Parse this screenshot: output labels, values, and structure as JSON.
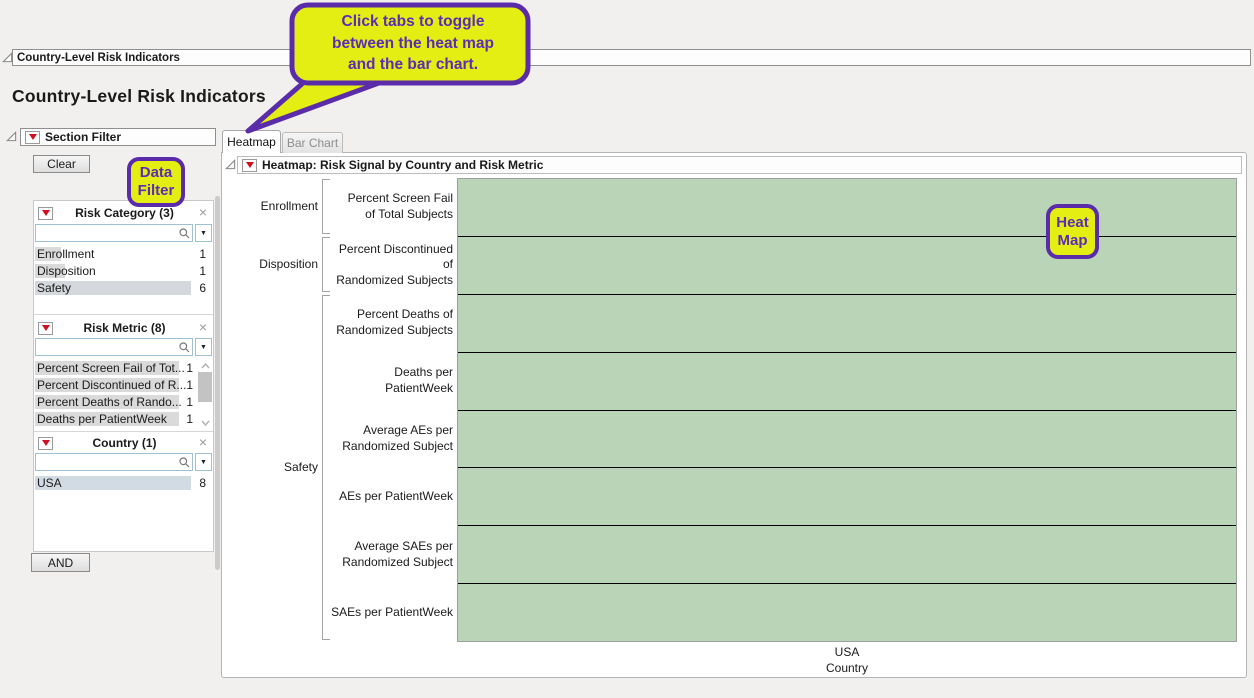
{
  "window": {
    "outline_title": "Country-Level Risk Indicators",
    "page_title": "Country-Level Risk Indicators"
  },
  "section_filter": {
    "title": "Section Filter",
    "clear_label": "Clear",
    "and_label": "AND",
    "filters": [
      {
        "title": "Risk Category (3)",
        "search_value": "",
        "items": [
          {
            "label": "Enrollment",
            "count": "1"
          },
          {
            "label": "Disposition",
            "count": "1"
          },
          {
            "label": "Safety",
            "count": "6"
          }
        ]
      },
      {
        "title": "Risk Metric (8)",
        "search_value": "",
        "items": [
          {
            "label": "Percent Screen Fail of Tot...",
            "count": "1"
          },
          {
            "label": "Percent Discontinued of R...",
            "count": "1"
          },
          {
            "label": "Percent Deaths of Rando...",
            "count": "1"
          },
          {
            "label": "Deaths per PatientWeek",
            "count": "1"
          }
        ]
      },
      {
        "title": "Country (1)",
        "search_value": "",
        "items": [
          {
            "label": "USA",
            "count": "8"
          }
        ]
      }
    ]
  },
  "tabs": [
    {
      "label": "Heatmap",
      "active": true
    },
    {
      "label": "Bar Chart",
      "active": false
    }
  ],
  "heatmap": {
    "outline_title": "Heatmap: Risk Signal by Country and Risk Metric",
    "cell_color": "#b9d4b6",
    "columns": [
      "USA"
    ],
    "x_axis_label": "Country",
    "categories": [
      "Enrollment",
      "Disposition",
      "Safety"
    ],
    "rows": [
      {
        "category": "Enrollment",
        "metric": "Percent Screen Fail\nof Total Subjects"
      },
      {
        "category": "Disposition",
        "metric": "Percent Discontinued of\nRandomized Subjects"
      },
      {
        "category": "Safety",
        "metric": "Percent Deaths of\nRandomized Subjects"
      },
      {
        "category": "Safety",
        "metric": "Deaths per PatientWeek"
      },
      {
        "category": "Safety",
        "metric": "Average AEs per\nRandomized Subject"
      },
      {
        "category": "Safety",
        "metric": "AEs per PatientWeek"
      },
      {
        "category": "Safety",
        "metric": "Average SAEs per\nRandomized Subject"
      },
      {
        "category": "Safety",
        "metric": "SAEs per PatientWeek"
      }
    ]
  },
  "callouts": {
    "tabs_note": "Click tabs to toggle\nbetween the heat map\nand the bar chart.",
    "data_filter": "Data\nFilter",
    "heat_map": "Heat\nMap",
    "fill_color": "#e4ee12",
    "border_color": "#5a2caa"
  }
}
